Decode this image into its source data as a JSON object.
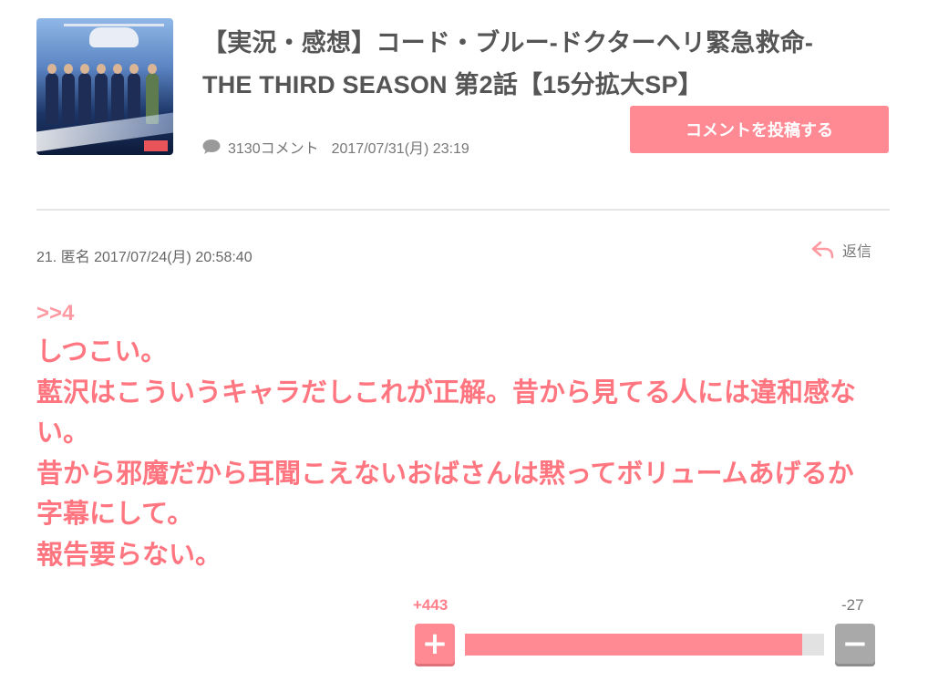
{
  "article": {
    "title_line1": "【実況・感想】コード・ブルー-ドクターヘリ緊急救命-",
    "title_line2": "THE THIRD SEASON 第2話【15分拡大SP】",
    "comment_count": "3130コメント",
    "date": "2017/07/31(月) 23:19",
    "post_button": "コメントを投稿する",
    "comment_icon": "speech-bubble-icon"
  },
  "comment": {
    "meta": "21. 匿名 2017/07/24(月) 20:58:40",
    "reply_label": "返信",
    "reply_icon": "reply-arrow-icon",
    "anchor": ">>4",
    "body_lines": [
      "しつこい。",
      "藍沢はこういうキャラだしこれが正解。昔から見てる人には違和感な",
      "い。",
      "昔から邪魔だから耳聞こえないおばさんは黙ってボリュームあげるか",
      "字幕にして。",
      "報告要らない。"
    ]
  },
  "votes": {
    "plus": "+443",
    "minus": "-27",
    "plus_label": "+",
    "minus_label": "−",
    "plus_ratio": 0.94
  },
  "colors": {
    "accent": "#ff8a94",
    "comment_text": "#ff7680",
    "anchor_text": "#ff9aa3",
    "minus_button": "#a9a9a9"
  }
}
